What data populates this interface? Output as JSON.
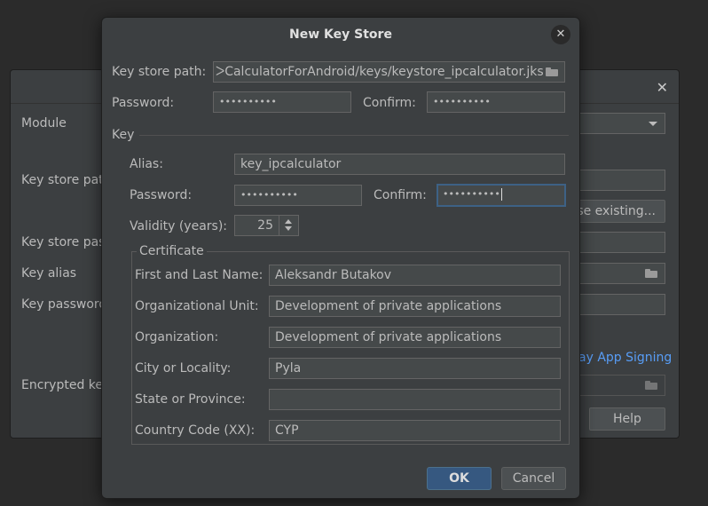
{
  "background_dialog": {
    "labels": {
      "module": "Module",
      "key_store_path": "Key store pat",
      "key_store_password": "Key store pas",
      "key_alias": "Key alias",
      "key_password": "Key password",
      "encrypted_key": "Encrypted ke"
    },
    "choose_existing_label": "se existing...",
    "play_app_signing_link": "ay App Signing",
    "help_label": "Help",
    "close_glyph": "✕"
  },
  "dialog": {
    "title": "New Key Store",
    "close_glyph": "✕",
    "key_store_path": {
      "label": "Key store path:",
      "value": "ᐳCalculatorForAndroid/keys/keystore_ipcalculator.jks"
    },
    "password": {
      "label": "Password:",
      "value": "••••••••••"
    },
    "confirm": {
      "label": "Confirm:",
      "value": "••••••••••"
    },
    "key_section": {
      "title": "Key",
      "alias": {
        "label": "Alias:",
        "value": "key_ipcalculator"
      },
      "password": {
        "label": "Password:",
        "value": "••••••••••"
      },
      "confirm": {
        "label": "Confirm:",
        "value": "••••••••••"
      },
      "validity": {
        "label": "Validity (years):",
        "value": "25"
      },
      "certificate": {
        "title": "Certificate",
        "first_last_name": {
          "label": "First and Last Name:",
          "value": "Aleksandr Butakov"
        },
        "org_unit": {
          "label": "Organizational Unit:",
          "value": "Development of private applications"
        },
        "organization": {
          "label": "Organization:",
          "value": "Development of private applications"
        },
        "city": {
          "label": "City or Locality:",
          "value": "Pyla"
        },
        "state": {
          "label": "State or Province:",
          "value": ""
        },
        "country": {
          "label": "Country Code (XX):",
          "value": "CYP"
        }
      }
    },
    "ok_label": "OK",
    "cancel_label": "Cancel"
  }
}
